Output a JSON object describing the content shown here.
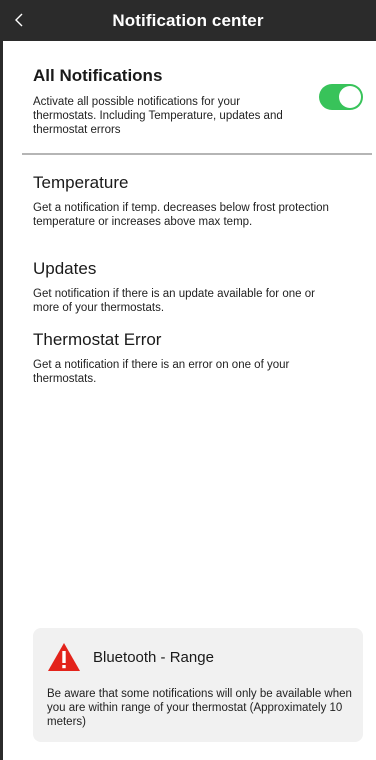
{
  "header": {
    "title": "Notification center"
  },
  "all_notifications": {
    "title": "All Notifications",
    "description": "Activate all possible notifications for your thermostats. Including Temperature, updates and thermostat errors",
    "toggle_on": true,
    "toggle_color": "#38c35a"
  },
  "sections": [
    {
      "title": "Temperature",
      "description": "Get a notification if temp. decreases below frost protection temperature or increases above max temp."
    },
    {
      "title": "Updates",
      "description": "Get notification if there is an update available for one or more of your thermostats."
    },
    {
      "title": "Thermostat Error",
      "description": "Get a notification if there is an error on one of your thermostats."
    }
  ],
  "info_card": {
    "icon": "warning-icon",
    "title": "Bluetooth - Range",
    "description": "Be aware that some notifications will only be available when you are within range of your thermostat (Approximately 10 meters)",
    "warning_color": "#e3231b"
  }
}
